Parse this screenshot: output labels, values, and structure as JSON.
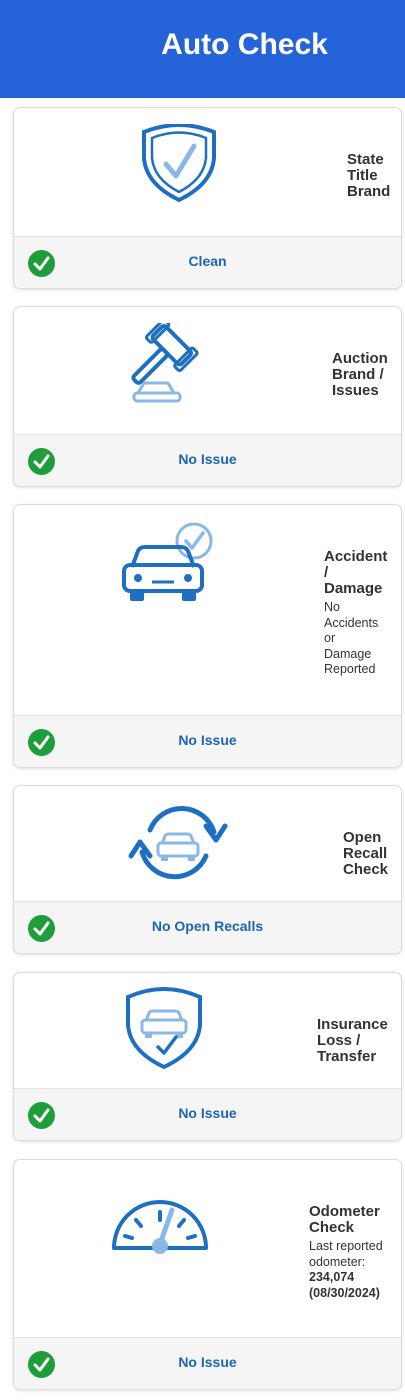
{
  "header": {
    "title": "Auto Check"
  },
  "cards": [
    {
      "title_lines": [
        "State",
        "Title",
        "Brand"
      ],
      "status": "Clean",
      "icon": "shield-check-icon"
    },
    {
      "title_lines": [
        "Auction",
        "Brand /",
        "Issues"
      ],
      "status": "No Issue",
      "icon": "gavel-icon"
    },
    {
      "title_lines": [
        "Accident",
        "/",
        "Damage"
      ],
      "sub_lines": [
        "No",
        "Accidents",
        "or",
        "Damage",
        "Reported"
      ],
      "status": "No Issue",
      "icon": "car-check-icon"
    },
    {
      "title_lines": [
        "Open",
        "Recall",
        "Check"
      ],
      "status": "No Open Recalls",
      "icon": "recall-car-icon"
    },
    {
      "title_lines": [
        "Insurance",
        "Loss /",
        "Transfer"
      ],
      "status": "No Issue",
      "icon": "shield-car-icon"
    },
    {
      "title_lines": [
        "Odometer",
        "Check"
      ],
      "sub_lines": [
        "Last reported",
        "odometer:"
      ],
      "sub_bold_lines": [
        "234,074",
        "(08/30/2024)"
      ],
      "status": "No Issue",
      "icon": "odometer-icon"
    }
  ],
  "colors": {
    "header_bg": "#2563d9",
    "icon_blue": "#1e6fc1",
    "icon_light": "#8ab8e6",
    "status_green": "#1f9d3a",
    "status_text": "#1f64b0"
  }
}
